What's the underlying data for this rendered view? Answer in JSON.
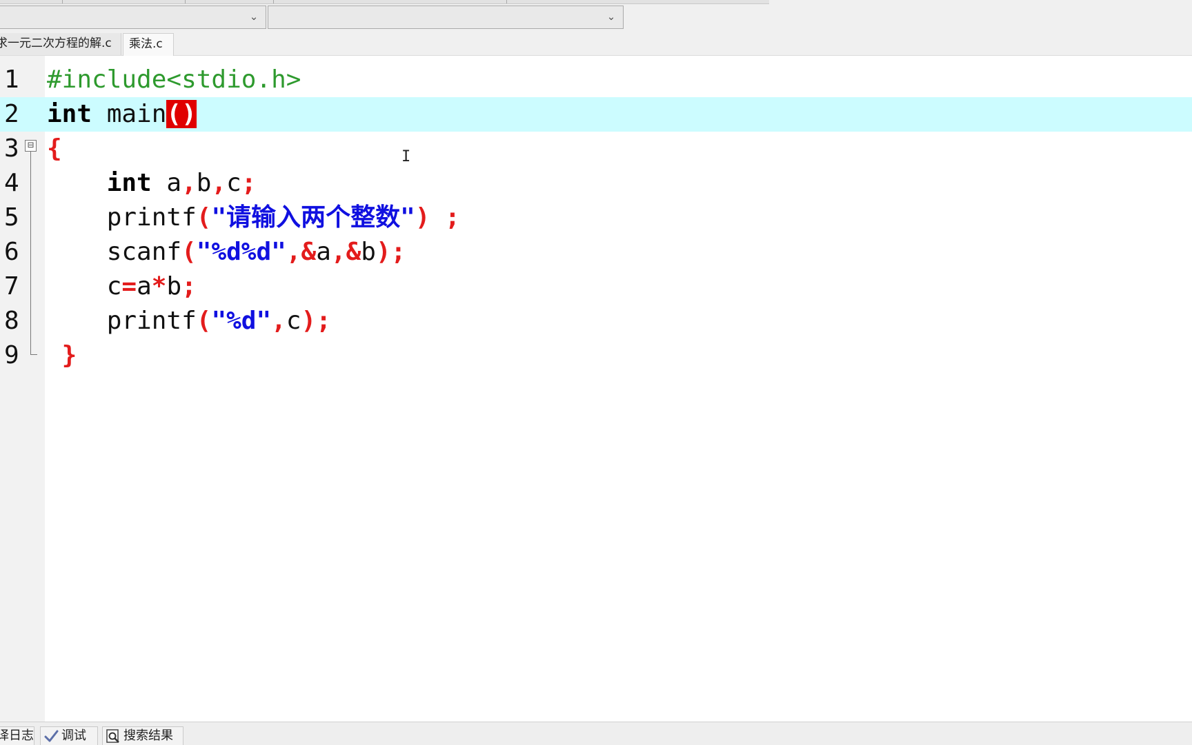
{
  "toolbar": {
    "combo1_value": "",
    "combo2_value": "",
    "chevron": "⌄"
  },
  "tabs": [
    {
      "label": "求一元二次方程的解.c",
      "active": false
    },
    {
      "label": "乘法.c",
      "active": true
    }
  ],
  "editor": {
    "current_line": 2,
    "line_numbers": [
      "1",
      "2",
      "3",
      "4",
      "5",
      "6",
      "7",
      "8",
      "9"
    ],
    "code": {
      "l1": "#include<stdio.h>",
      "l2_kw": "int",
      "l2_id": " main",
      "l2_paren": "()",
      "l3_brace": "{",
      "l4_indent": "    ",
      "l4_kw": "int",
      "l4_a": " a",
      "l4_c1": ",",
      "l4_b": "b",
      "l4_c2": ",",
      "l4_c": "c",
      "l4_semi": ";",
      "l5_fn": "printf",
      "l5_open": "(",
      "l5_str": "\"请输入两个整数\"",
      "l5_close": ")",
      "l5_semi": " ;",
      "l6_fn": "scanf",
      "l6_open": "(",
      "l6_str": "\"%d%d\"",
      "l6_c1": ",",
      "l6_amp1": "&",
      "l6_a": "a",
      "l6_c2": ",",
      "l6_amp2": "&",
      "l6_b": "b",
      "l6_close": ");",
      "l7_c": "c",
      "l7_eq": "=",
      "l7_a": "a",
      "l7_star": "*",
      "l7_b": "b",
      "l7_semi": ";",
      "l8_fn": "printf",
      "l8_open": "(",
      "l8_str": "\"%d\"",
      "l8_comma": ",",
      "l8_c": "c",
      "l8_close": ");",
      "l9_brace": " }"
    },
    "fold_toggle": "⊟"
  },
  "bottom_panels": [
    {
      "label": "译日志",
      "icon": "log-icon"
    },
    {
      "label": "调试",
      "icon": "check-icon"
    },
    {
      "label": "搜索结果",
      "icon": "search-icon"
    }
  ],
  "colors": {
    "preprocessor": "#2e9a2e",
    "keyword": "#000000",
    "punctuation": "#e31c1c",
    "string": "#1010e0",
    "current_line_bg": "#ccfcff",
    "matched_bracket_bg": "#e00000"
  }
}
